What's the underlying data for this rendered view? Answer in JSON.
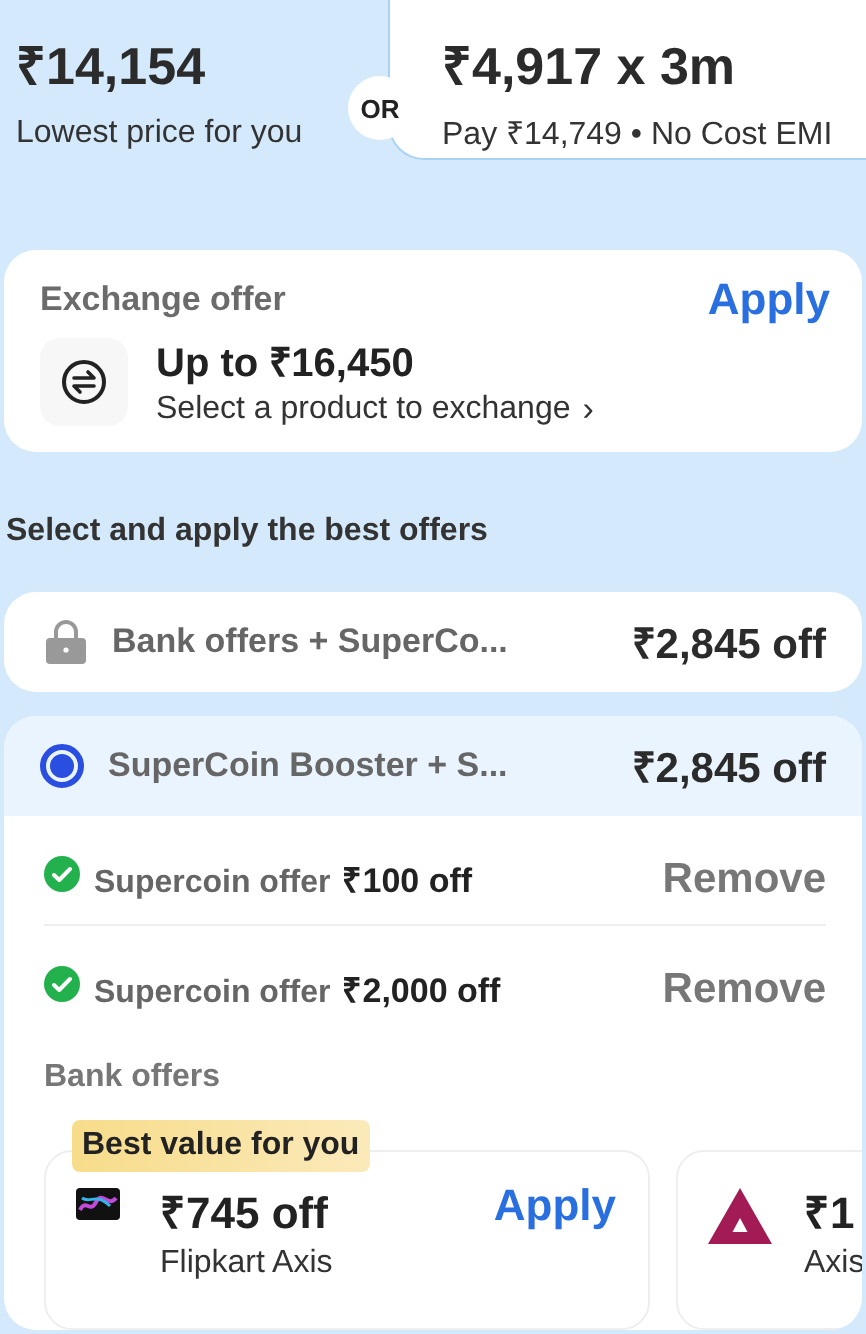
{
  "price_options": {
    "lowest": {
      "amount": "₹14,154",
      "caption": "Lowest price for you"
    },
    "separator": "OR",
    "emi": {
      "amount": "₹4,917 x 3m",
      "caption": "Pay ₹14,749 • No Cost EMI"
    }
  },
  "exchange_offer": {
    "title": "Exchange offer",
    "action": "Apply",
    "amount": "Up to ₹16,450",
    "subtitle": "Select a product to exchange",
    "chevron": "›"
  },
  "offers_heading": "Select and apply the best offers",
  "offer_groups": [
    {
      "kind": "locked",
      "selected": false,
      "title": "Bank offers + SuperCo...",
      "discount": "₹2,845 off"
    },
    {
      "kind": "radio",
      "selected": true,
      "title": "SuperCoin Booster + S...",
      "discount": "₹2,845 off",
      "applied": [
        {
          "label": "Supercoin offer",
          "amount": "₹100 off",
          "action": "Remove"
        },
        {
          "label": "Supercoin offer",
          "amount": "₹2,000 off",
          "action": "Remove"
        }
      ],
      "bank_offers_title": "Bank offers",
      "bank_offers": [
        {
          "badge": "Best value for you",
          "amount": "₹745 off",
          "bank": "Flipkart Axis",
          "action": "Apply",
          "kind": "card"
        },
        {
          "amount": "₹1",
          "bank": "Axis",
          "kind": "axis"
        }
      ]
    }
  ]
}
